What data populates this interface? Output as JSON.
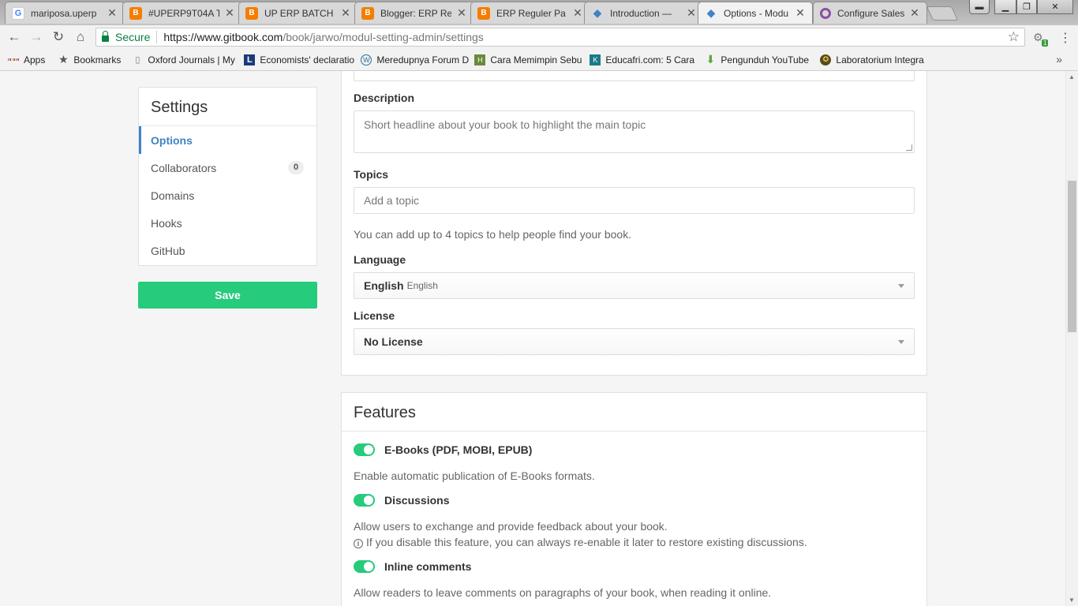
{
  "tabs": [
    {
      "title": "mariposa.uperp",
      "icon": "google-icon"
    },
    {
      "title": "#UPERP9T04A T",
      "icon": "blogger-icon"
    },
    {
      "title": "UP ERP BATCH",
      "icon": "blogger-icon"
    },
    {
      "title": "Blogger: ERP Re",
      "icon": "blogger-icon"
    },
    {
      "title": "ERP Reguler Pa",
      "icon": "blogger-icon"
    },
    {
      "title": "Introduction —",
      "icon": "gitbook-icon"
    },
    {
      "title": "Options - Modu",
      "icon": "gitbook-icon",
      "active": true
    },
    {
      "title": "Configure Sales",
      "icon": "ring-icon"
    }
  ],
  "omnibox": {
    "secure_label": "Secure",
    "url_host": "https://www.gitbook.com",
    "url_path": "/book/jarwo/modul-setting-admin/settings"
  },
  "bookmarks": [
    {
      "label": "Apps"
    },
    {
      "label": "Bookmarks"
    },
    {
      "label": "Oxford Journals | My"
    },
    {
      "label": "Economists' declaratio"
    },
    {
      "label": "Meredupnya Forum D"
    },
    {
      "label": "Cara Memimpin Sebu"
    },
    {
      "label": "Educafri.com: 5 Cara"
    },
    {
      "label": "Pengunduh YouTube"
    },
    {
      "label": "Laboratorium Integra"
    }
  ],
  "sidebar": {
    "title": "Settings",
    "items": [
      {
        "label": "Options"
      },
      {
        "label": "Collaborators",
        "badge": "0"
      },
      {
        "label": "Domains"
      },
      {
        "label": "Hooks"
      },
      {
        "label": "GitHub"
      }
    ],
    "save_label": "Save"
  },
  "options": {
    "description_label": "Description",
    "description_placeholder": "Short headline about your book to highlight the main topic",
    "topics_label": "Topics",
    "topics_placeholder": "Add a topic",
    "topics_help": "You can add up to 4 topics to help people find your book.",
    "language_label": "Language",
    "language_value": "English",
    "language_native": "English",
    "license_label": "License",
    "license_value": "No License"
  },
  "features": {
    "title": "Features",
    "items": [
      {
        "label": "E-Books (PDF, MOBI, EPUB)",
        "desc": "Enable automatic publication of E-Books formats.",
        "enabled": true
      },
      {
        "label": "Discussions",
        "desc": "Allow users to exchange and provide feedback about your book.",
        "note": "If you disable this feature, you can always re-enable it later to restore existing discussions.",
        "enabled": true
      },
      {
        "label": "Inline comments",
        "desc": "Allow readers to leave comments on paragraphs of your book, when reading it online.",
        "enabled": true
      }
    ]
  },
  "colors": {
    "accent": "#4183c4",
    "toggle_on": "#26cb7c",
    "save_button": "#26cb7c"
  }
}
